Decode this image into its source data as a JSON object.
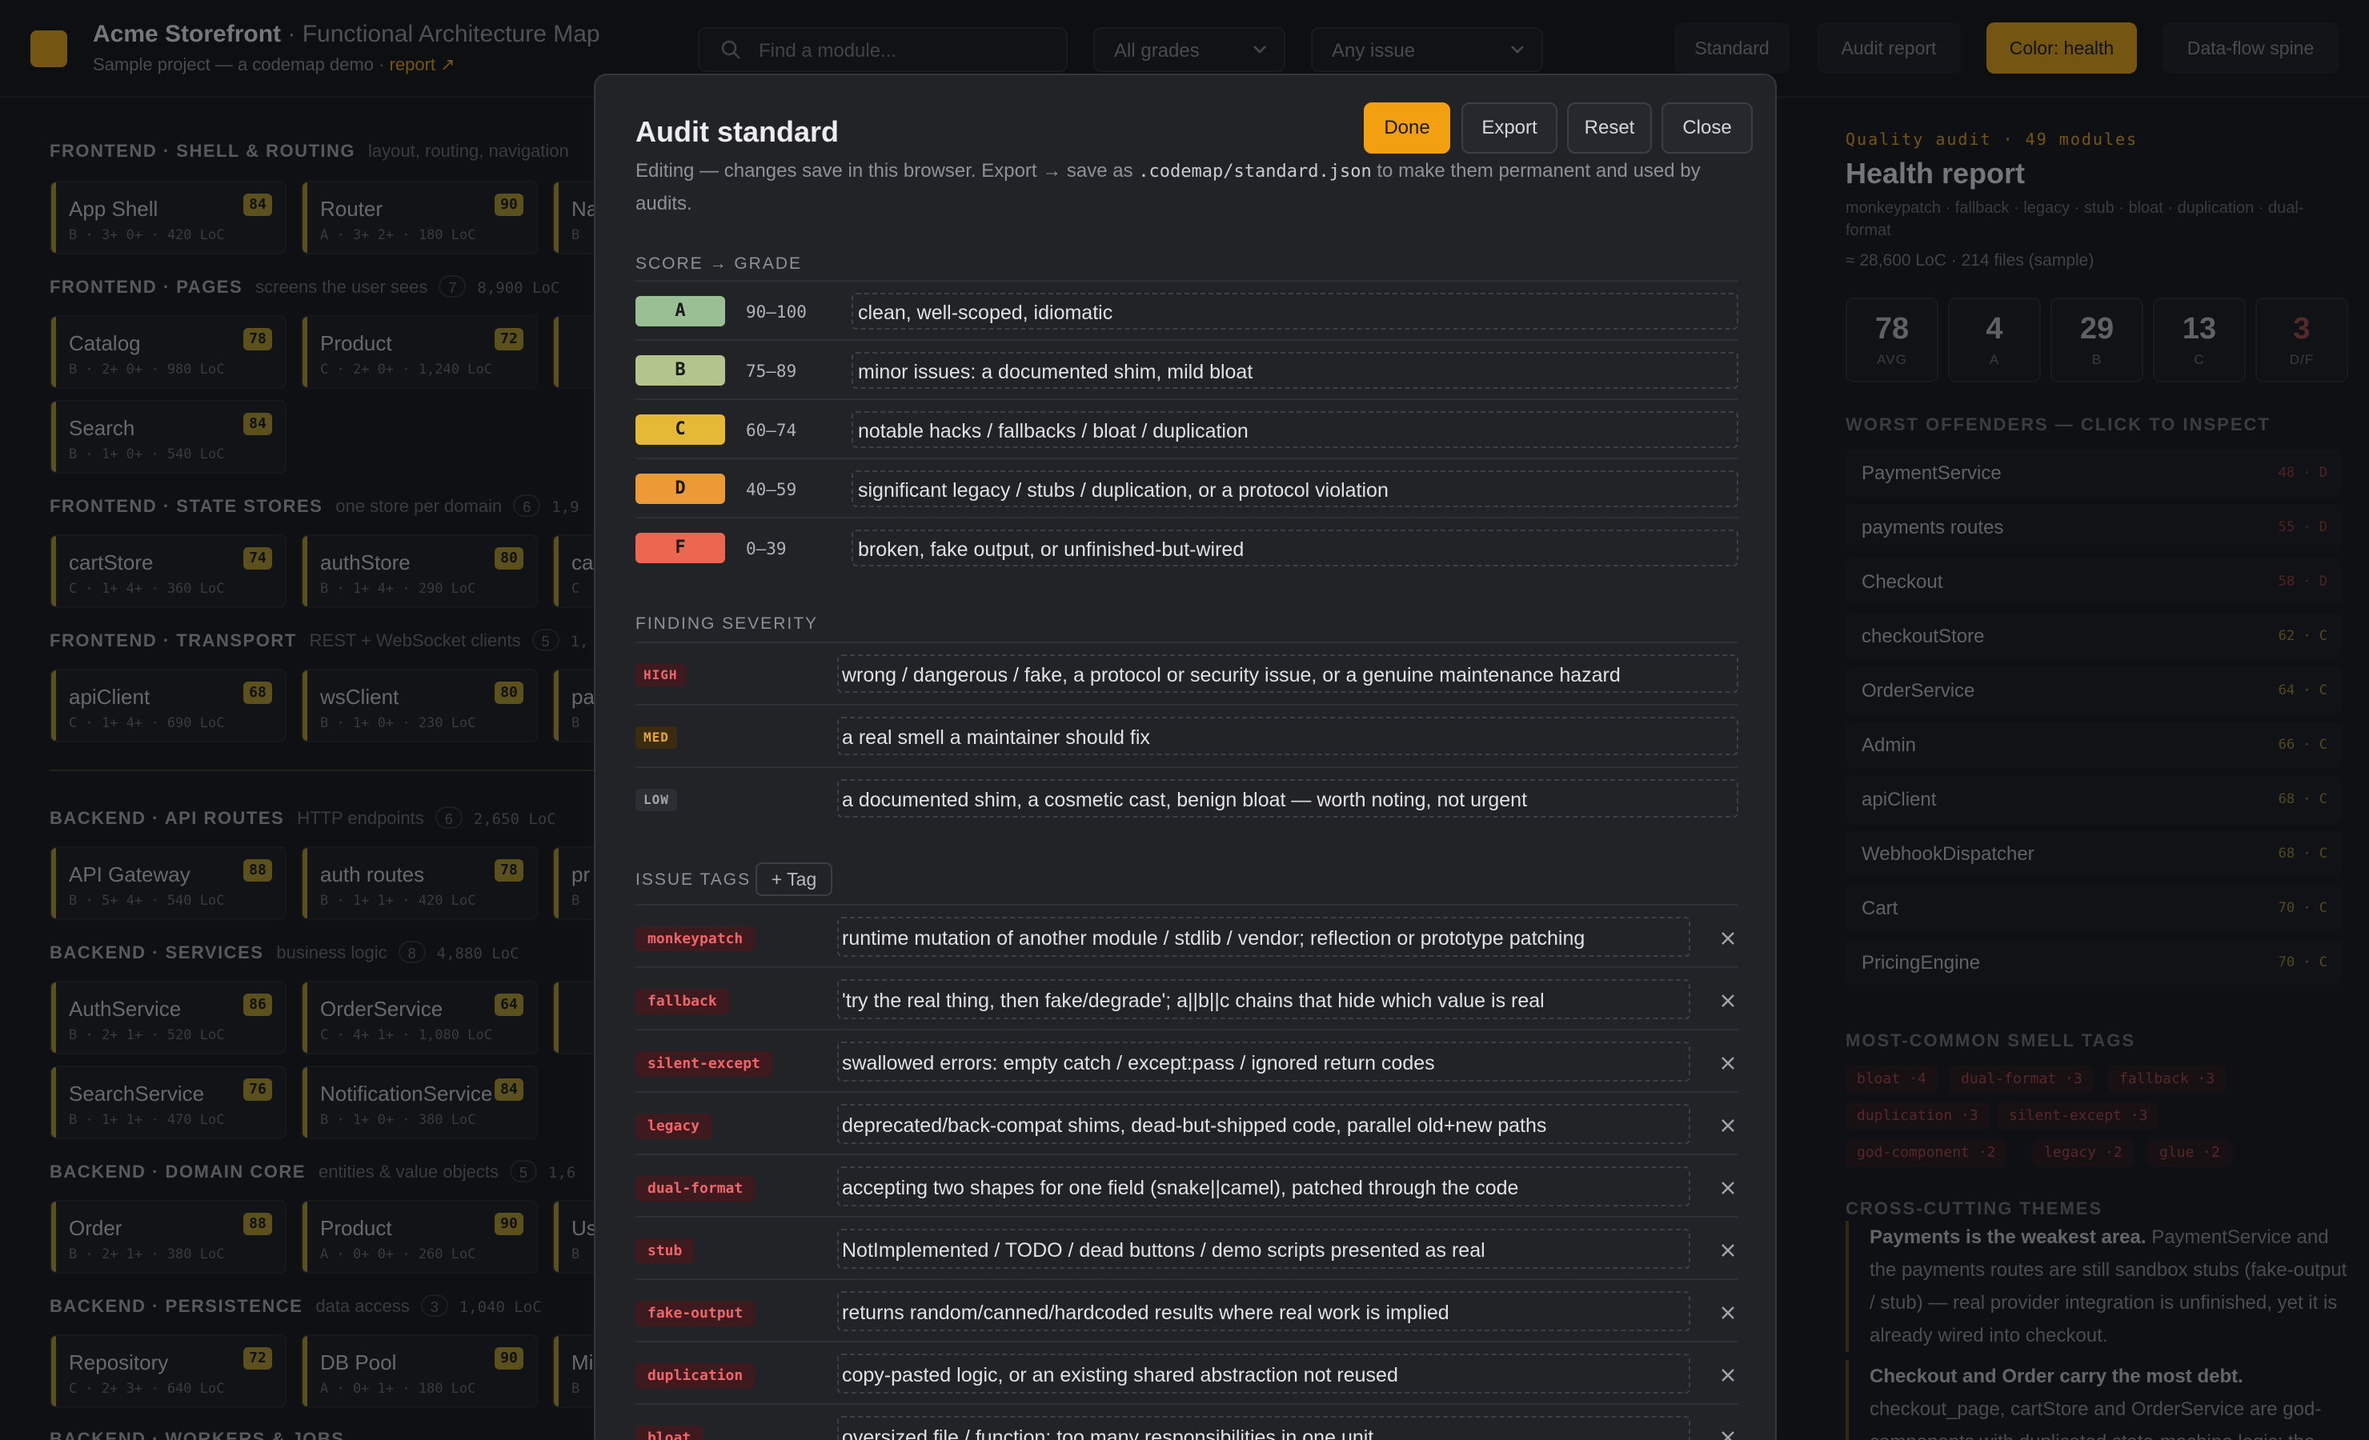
{
  "app": {
    "title": "Acme Storefront",
    "title_sep": "·",
    "title_suffix": "Functional Architecture Map",
    "subtitle": "Sample project — a codemap demo ·",
    "subtitle_link": "report ↗",
    "search_placeholder": "Find a module...",
    "grade_filter": "All grades",
    "issue_filter": "Any issue",
    "toolbar": [
      "Standard",
      "Audit report",
      "Color: health",
      "Data-flow spine"
    ]
  },
  "sections": [
    {
      "title": "FRONTEND · SHELL & ROUTING",
      "desc": "layout, routing, navigation",
      "count": "",
      "loc": "",
      "cards": [
        {
          "name": "App Shell",
          "score": "84",
          "meta": "B · 3+ 0+ · 420 LoC"
        },
        {
          "name": "Router",
          "score": "90",
          "meta": "A · 3+ 2+ · 180 LoC"
        },
        {
          "name": "Na",
          "score": "",
          "meta": "B"
        }
      ]
    },
    {
      "title": "FRONTEND · PAGES",
      "desc": "screens the user sees",
      "count": "7",
      "loc": "8,900 LoC",
      "cards": [
        {
          "name": "Catalog",
          "score": "78",
          "meta": "B · 2+ 0+ · 980 LoC"
        },
        {
          "name": "Product",
          "score": "72",
          "meta": "C · 2+ 0+ · 1,240 LoC"
        },
        {
          "name": "Search",
          "score": "84",
          "meta": "B · 1+ 0+ · 540 LoC"
        }
      ]
    },
    {
      "title": "FRONTEND · STATE STORES",
      "desc": "one store per domain",
      "count": "6",
      "loc": "1,9",
      "cards": [
        {
          "name": "cartStore",
          "score": "74",
          "meta": "C · 1+ 4+ · 360 LoC"
        },
        {
          "name": "authStore",
          "score": "80",
          "meta": "B · 1+ 4+ · 290 LoC"
        },
        {
          "name": "ca",
          "score": "",
          "meta": "C"
        }
      ]
    },
    {
      "title": "FRONTEND · TRANSPORT",
      "desc": "REST + WebSocket clients",
      "count": "5",
      "loc": "1,",
      "cards": [
        {
          "name": "apiClient",
          "score": "68",
          "meta": "C · 1+ 4+ · 690 LoC"
        },
        {
          "name": "wsClient",
          "score": "80",
          "meta": "B · 1+ 0+ · 230 LoC"
        },
        {
          "name": "pa",
          "score": "",
          "meta": "B"
        }
      ]
    },
    {
      "title": "BACKEND · API ROUTES",
      "desc": "HTTP endpoints",
      "count": "6",
      "loc": "2,650 LoC",
      "cards": [
        {
          "name": "API Gateway",
          "score": "88",
          "meta": "B · 5+ 4+ · 540 LoC"
        },
        {
          "name": "auth routes",
          "score": "78",
          "meta": "B · 1+ 1+ · 420 LoC"
        },
        {
          "name": "pr",
          "score": "",
          "meta": "B"
        }
      ]
    },
    {
      "title": "BACKEND · SERVICES",
      "desc": "business logic",
      "count": "8",
      "loc": "4,880 LoC",
      "cards": [
        {
          "name": "AuthService",
          "score": "86",
          "meta": "B · 2+ 1+ · 520 LoC"
        },
        {
          "name": "OrderService",
          "score": "64",
          "meta": "C · 4+ 1+ · 1,080 LoC"
        },
        {
          "name": "",
          "score": "",
          "meta": ""
        },
        {
          "name": "SearchService",
          "score": "76",
          "meta": "B · 1+ 1+ · 470 LoC"
        },
        {
          "name": "NotificationService",
          "score": "84",
          "meta": "B · 1+ 0+ · 380 LoC"
        }
      ]
    },
    {
      "title": "BACKEND · DOMAIN CORE",
      "desc": "entities & value objects",
      "count": "5",
      "loc": "1,6",
      "cards": [
        {
          "name": "Order",
          "score": "88",
          "meta": "B · 2+ 1+ · 380 LoC"
        },
        {
          "name": "Product",
          "score": "90",
          "meta": "A · 0+ 0+ · 260 LoC"
        },
        {
          "name": "Us",
          "score": "",
          "meta": "B"
        }
      ]
    },
    {
      "title": "BACKEND · PERSISTENCE",
      "desc": "data access",
      "count": "3",
      "loc": "1,040 LoC",
      "cards": [
        {
          "name": "Repository",
          "score": "72",
          "meta": "C · 2+ 3+ · 640 LoC"
        },
        {
          "name": "DB Pool",
          "score": "90",
          "meta": "A · 0+ 1+ · 180 LoC"
        },
        {
          "name": "Mi",
          "score": "",
          "meta": "B"
        }
      ]
    },
    {
      "title": "BACKEND · WORKERS & JOBS",
      "desc": "",
      "count": "",
      "loc": "",
      "cards": []
    }
  ],
  "report": {
    "kicker": "Quality audit · 49 modules",
    "title": "Health report",
    "tags_line": "monkeypatch · fallback · legacy · stub · bloat · duplication · dual-format",
    "stats_line": "≈ 28,600 LoC · 214 files (sample)",
    "stats": [
      {
        "n": "78",
        "l": "AVG"
      },
      {
        "n": "4",
        "l": "A"
      },
      {
        "n": "29",
        "l": "B"
      },
      {
        "n": "13",
        "l": "C"
      },
      {
        "n": "3",
        "l": "D/F"
      }
    ],
    "offenders_heading": "WORST OFFENDERS — CLICK TO INSPECT",
    "offenders": [
      {
        "name": "PaymentService",
        "rating": "48 · D"
      },
      {
        "name": "payments routes",
        "rating": "55 · D"
      },
      {
        "name": "Checkout",
        "rating": "58 · D"
      },
      {
        "name": "checkoutStore",
        "rating": "62 · C"
      },
      {
        "name": "OrderService",
        "rating": "64 · C"
      },
      {
        "name": "Admin",
        "rating": "66 · C"
      },
      {
        "name": "apiClient",
        "rating": "68 · C"
      },
      {
        "name": "WebhookDispatcher",
        "rating": "68 · C"
      },
      {
        "name": "Cart",
        "rating": "70 · C"
      },
      {
        "name": "PricingEngine",
        "rating": "70 · C"
      }
    ],
    "smell_heading": "MOST-COMMON SMELL TAGS",
    "smell_tags": [
      "bloat ·4",
      "dual-format ·3",
      "fallback ·3",
      "duplication ·3",
      "silent-except ·3",
      "god-component ·2",
      "legacy ·2",
      "glue ·2"
    ],
    "themes_heading": "CROSS-CUTTING THEMES",
    "theme1_bold": "Payments is the weakest area.",
    "theme1_text": "PaymentService and the payments routes are still sandbox stubs (fake-output / stub) — real provider integration is unfinished, yet it is already wired into checkout.",
    "theme2_bold": "Checkout and Order carry the most debt.",
    "theme2_text": "checkout_page, cartStore and OrderService are god-components with duplicated state-machine logic; the"
  },
  "modal": {
    "title": "Audit standard",
    "desc_prefix": "Editing — changes save in this browser. Export → save as",
    "desc_code": ".codemap/standard.json",
    "desc_suffix": "to make them permanent and used by audits.",
    "buttons": {
      "done": "Done",
      "export": "Export",
      "reset": "Reset",
      "close": "Close"
    },
    "grade_heading": "SCORE → GRADE",
    "grades": [
      {
        "grade": "A",
        "range": "90–100",
        "desc": "clean, well-scoped, idiomatic",
        "color": "#9bbf94"
      },
      {
        "grade": "B",
        "range": "75–89",
        "desc": "minor issues: a documented shim, mild bloat",
        "color": "#b3c48d"
      },
      {
        "grade": "C",
        "range": "60–74",
        "desc": "notable hacks / fallbacks / bloat / duplication",
        "color": "#e5b935"
      },
      {
        "grade": "D",
        "range": "40–59",
        "desc": "significant legacy / stubs / duplication, or a protocol violation",
        "color": "#eb9a36"
      },
      {
        "grade": "F",
        "range": "0–39",
        "desc": "broken, fake output, or unfinished-but-wired",
        "color": "#ec6650"
      }
    ],
    "severity_heading": "FINDING SEVERITY",
    "severities": [
      {
        "level": "HIGH",
        "desc": "wrong / dangerous / fake, a protocol or security issue, or a genuine maintenance hazard",
        "bg": "#3d1a1e",
        "fg": "#f0646a"
      },
      {
        "level": "MED",
        "desc": "a real smell a maintainer should fix",
        "bg": "#3a2c10",
        "fg": "#e8a63a"
      },
      {
        "level": "LOW",
        "desc": "a documented shim, a cosmetic cast, benign bloat — worth noting, not urgent",
        "bg": "#2c2e33",
        "fg": "#a2a4a9"
      }
    ],
    "tags_heading": "ISSUE TAGS",
    "add_tag": "+ Tag",
    "tags": [
      {
        "tag": "monkeypatch",
        "desc": "runtime mutation of another module / stdlib / vendor; reflection or prototype patching"
      },
      {
        "tag": "fallback",
        "desc": "'try the real thing, then fake/degrade'; a||b||c chains that hide which value is real"
      },
      {
        "tag": "silent-except",
        "desc": "swallowed errors: empty catch / except:pass / ignored return codes"
      },
      {
        "tag": "legacy",
        "desc": "deprecated/back-compat shims, dead-but-shipped code, parallel old+new paths"
      },
      {
        "tag": "dual-format",
        "desc": "accepting two shapes for one field (snake||camel), patched through the code"
      },
      {
        "tag": "stub",
        "desc": "NotImplemented / TODO / dead buttons / demo scripts presented as real"
      },
      {
        "tag": "fake-output",
        "desc": "returns random/canned/hardcoded results where real work is implied"
      },
      {
        "tag": "duplication",
        "desc": "copy-pasted logic, or an existing shared abstraction not reused"
      },
      {
        "tag": "bloat",
        "desc": "oversized file / function; too many responsibilities in one unit"
      }
    ]
  }
}
